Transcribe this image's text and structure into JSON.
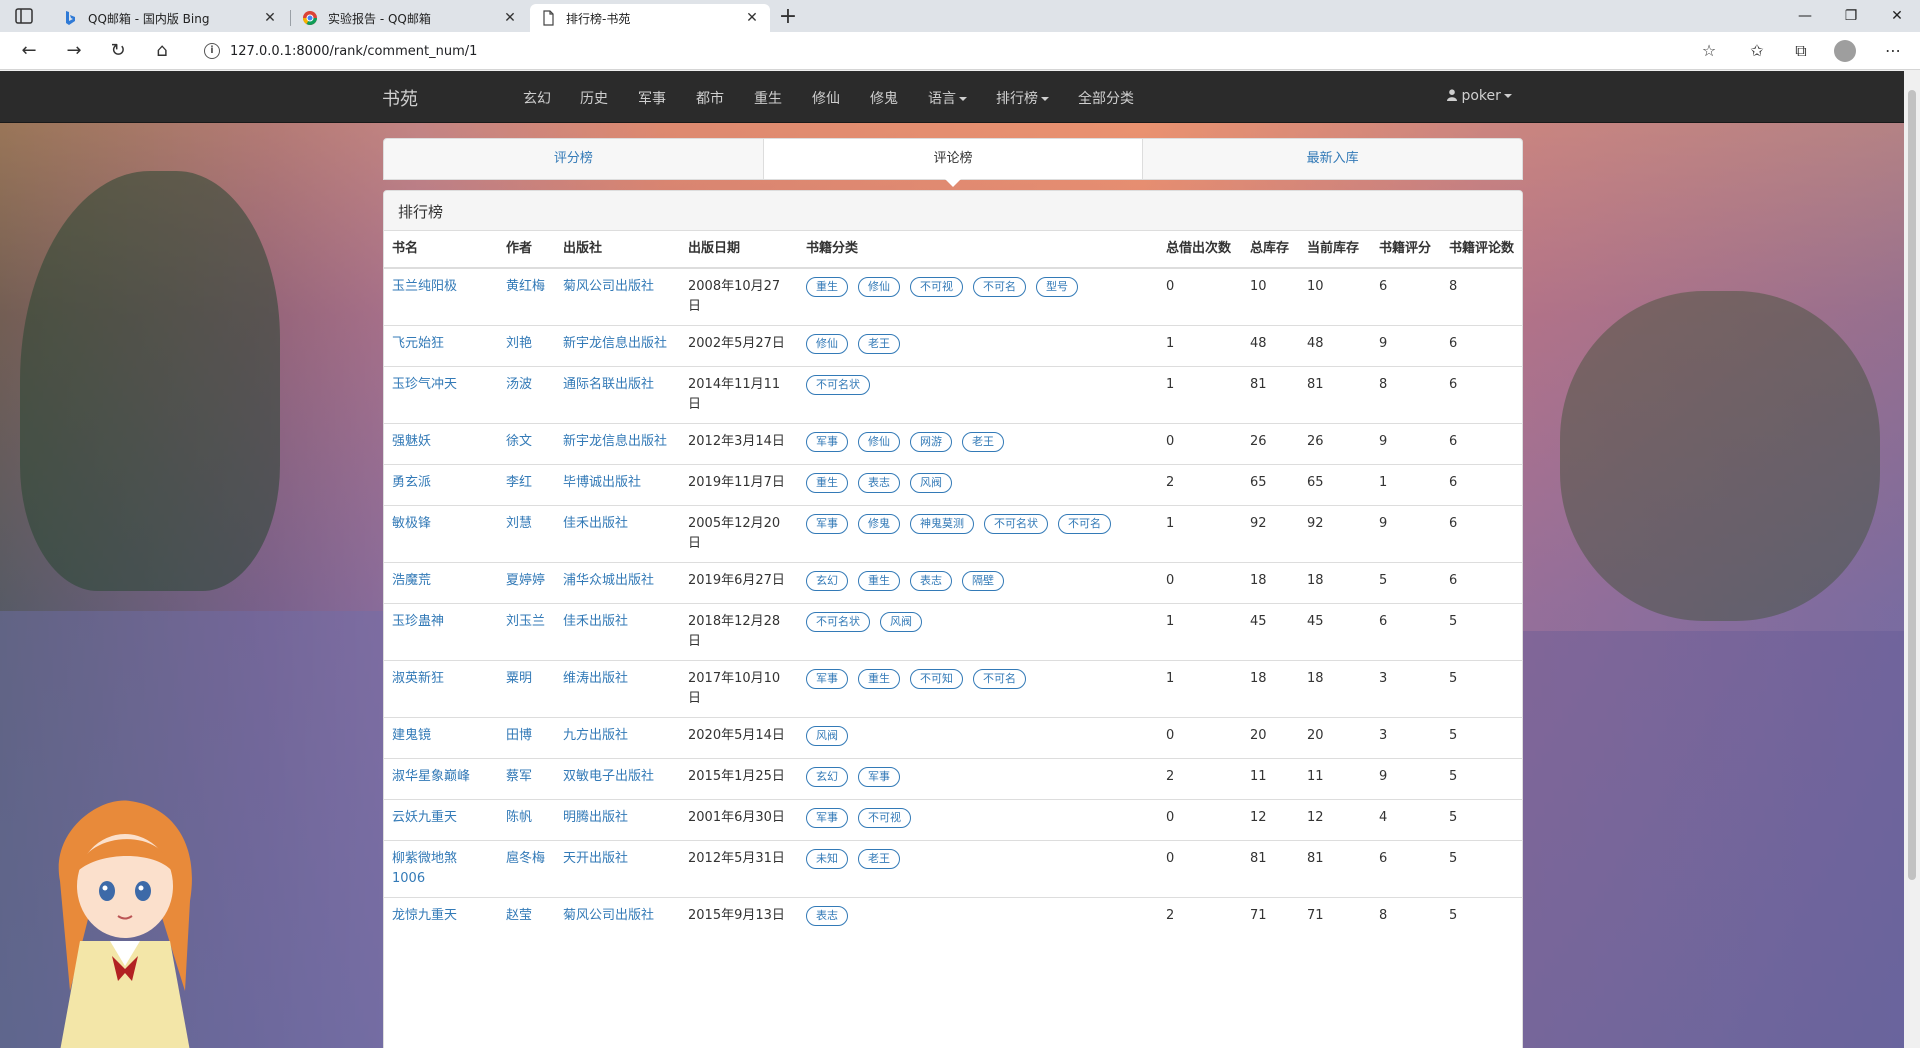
{
  "browser": {
    "tabs": [
      {
        "title": "QQ邮箱 - 国内版 Bing",
        "favicon": "bing-icon"
      },
      {
        "title": "实验报告 - QQ邮箱",
        "favicon": "chrome-icon"
      },
      {
        "title": "排行榜-书苑",
        "favicon": "page-icon"
      }
    ],
    "url": "127.0.0.1:8000/rank/comment_num/1"
  },
  "navbar": {
    "brand": "书苑",
    "items": [
      "玄幻",
      "历史",
      "军事",
      "都市",
      "重生",
      "修仙",
      "修鬼"
    ],
    "dropdowns": [
      "语言",
      "排行榜"
    ],
    "all": "全部分类",
    "user": "poker"
  },
  "rank_tabs": [
    "评分榜",
    "评论榜",
    "最新入库"
  ],
  "panel": {
    "title": "排行榜",
    "columns": [
      "书名",
      "作者",
      "出版社",
      "出版日期",
      "书籍分类",
      "总借出次数",
      "总库存",
      "当前库存",
      "书籍评分",
      "书籍评论数"
    ],
    "rows": [
      {
        "name": "玉兰纯阳极",
        "author": "黄红梅",
        "publisher": "菊风公司出版社",
        "date": "2008年10月27日",
        "tags": [
          "重生",
          "修仙",
          "不可视",
          "不可名",
          "型号"
        ],
        "borrow": "0",
        "stock": "10",
        "current": "10",
        "score": "6",
        "comments": "8"
      },
      {
        "name": "飞元始狂",
        "author": "刘艳",
        "publisher": "新宇龙信息出版社",
        "date": "2002年5月27日",
        "tags": [
          "修仙",
          "老王"
        ],
        "borrow": "1",
        "stock": "48",
        "current": "48",
        "score": "9",
        "comments": "6"
      },
      {
        "name": "玉珍气冲天",
        "author": "汤波",
        "publisher": "通际名联出版社",
        "date": "2014年11月11日",
        "tags": [
          "不可名状"
        ],
        "borrow": "1",
        "stock": "81",
        "current": "81",
        "score": "8",
        "comments": "6"
      },
      {
        "name": "强魅妖",
        "author": "徐文",
        "publisher": "新宇龙信息出版社",
        "date": "2012年3月14日",
        "tags": [
          "军事",
          "修仙",
          "网游",
          "老王"
        ],
        "borrow": "0",
        "stock": "26",
        "current": "26",
        "score": "9",
        "comments": "6"
      },
      {
        "name": "勇玄派",
        "author": "李红",
        "publisher": "毕博诚出版社",
        "date": "2019年11月7日",
        "tags": [
          "重生",
          "表志",
          "风阀"
        ],
        "borrow": "2",
        "stock": "65",
        "current": "65",
        "score": "1",
        "comments": "6"
      },
      {
        "name": "敏极锋",
        "author": "刘慧",
        "publisher": "佳禾出版社",
        "date": "2005年12月20日",
        "tags": [
          "军事",
          "修鬼",
          "神鬼莫测",
          "不可名状",
          "不可名"
        ],
        "borrow": "1",
        "stock": "92",
        "current": "92",
        "score": "9",
        "comments": "6"
      },
      {
        "name": "浩魔荒",
        "author": "夏婷婷",
        "publisher": "浦华众城出版社",
        "date": "2019年6月27日",
        "tags": [
          "玄幻",
          "重生",
          "表志",
          "隔壁"
        ],
        "borrow": "0",
        "stock": "18",
        "current": "18",
        "score": "5",
        "comments": "6"
      },
      {
        "name": "玉珍蛊神",
        "author": "刘玉兰",
        "publisher": "佳禾出版社",
        "date": "2018年12月28日",
        "tags": [
          "不可名状",
          "风阀"
        ],
        "borrow": "1",
        "stock": "45",
        "current": "45",
        "score": "6",
        "comments": "5"
      },
      {
        "name": "淑英新狂",
        "author": "粟明",
        "publisher": "维涛出版社",
        "date": "2017年10月10日",
        "tags": [
          "军事",
          "重生",
          "不可知",
          "不可名"
        ],
        "borrow": "1",
        "stock": "18",
        "current": "18",
        "score": "3",
        "comments": "5"
      },
      {
        "name": "建鬼镜",
        "author": "田博",
        "publisher": "九方出版社",
        "date": "2020年5月14日",
        "tags": [
          "风阀"
        ],
        "borrow": "0",
        "stock": "20",
        "current": "20",
        "score": "3",
        "comments": "5"
      },
      {
        "name": "淑华星象巅峰",
        "author": "蔡军",
        "publisher": "双敏电子出版社",
        "date": "2015年1月25日",
        "tags": [
          "玄幻",
          "军事"
        ],
        "borrow": "2",
        "stock": "11",
        "current": "11",
        "score": "9",
        "comments": "5"
      },
      {
        "name": "云妖九重天",
        "author": "陈帆",
        "publisher": "明腾出版社",
        "date": "2001年6月30日",
        "tags": [
          "军事",
          "不可视"
        ],
        "borrow": "0",
        "stock": "12",
        "current": "12",
        "score": "4",
        "comments": "5"
      },
      {
        "name": "柳紫微地煞1006",
        "author": "扈冬梅",
        "publisher": "天开出版社",
        "date": "2012年5月31日",
        "tags": [
          "未知",
          "老王"
        ],
        "borrow": "0",
        "stock": "81",
        "current": "81",
        "score": "6",
        "comments": "5"
      },
      {
        "name": "龙惊九重天",
        "author": "赵莹",
        "publisher": "菊风公司出版社",
        "date": "2015年9月13日",
        "tags": [
          "表志"
        ],
        "borrow": "2",
        "stock": "71",
        "current": "71",
        "score": "8",
        "comments": "5"
      }
    ]
  },
  "colors": {
    "link": "#337ab7",
    "navbar": "#2b2b2b"
  }
}
